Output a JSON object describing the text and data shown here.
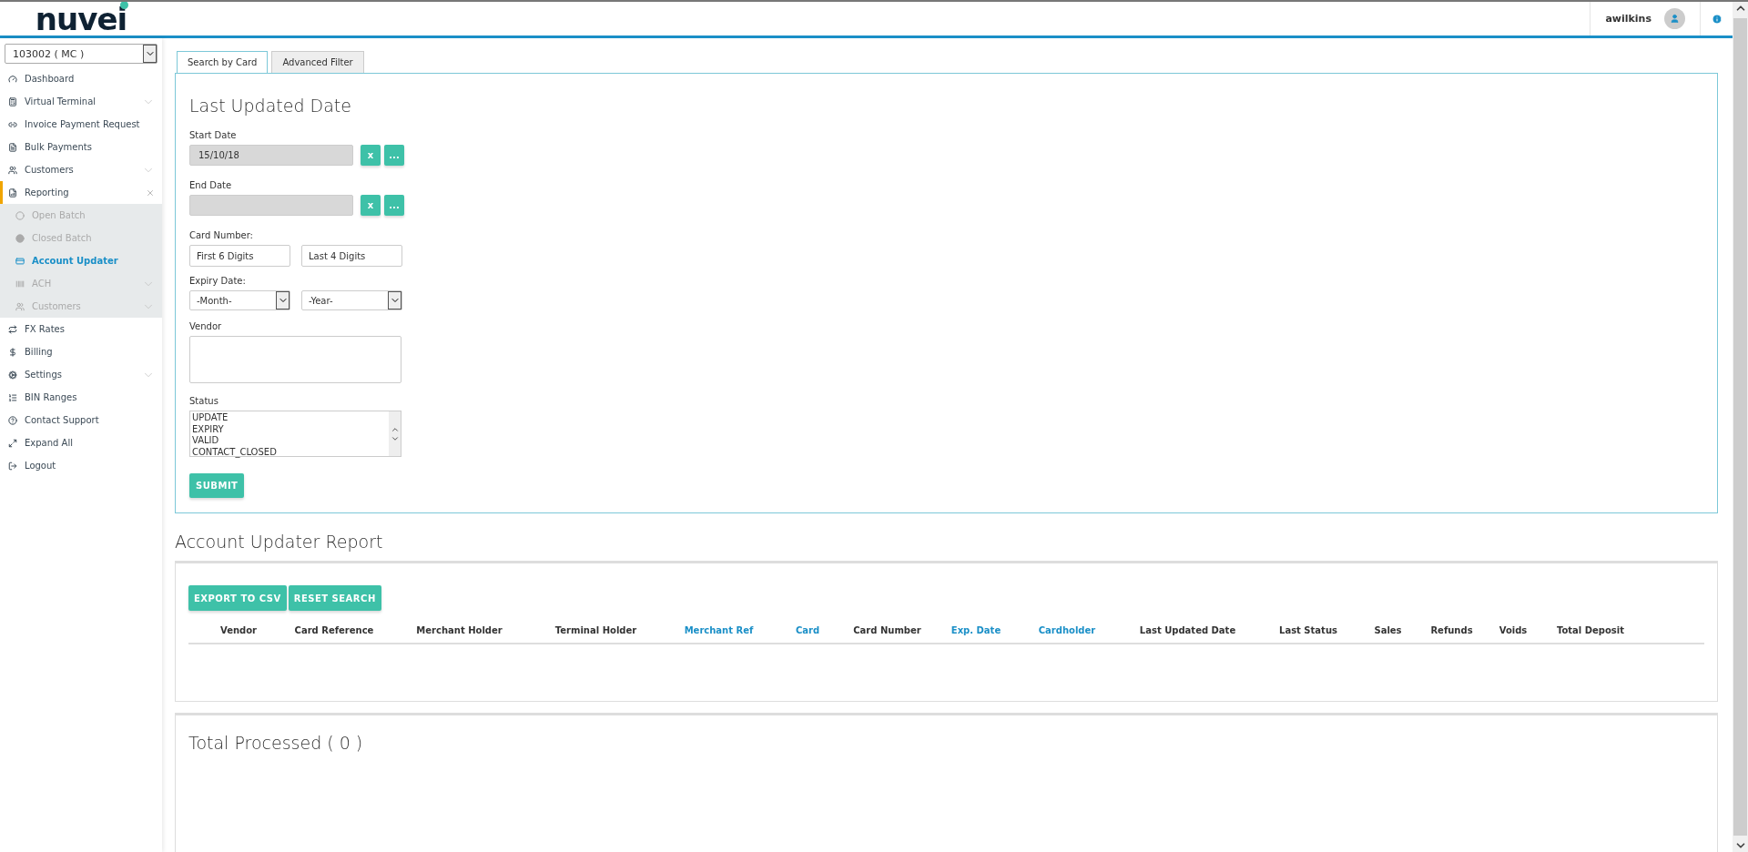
{
  "header": {
    "username": "awilkins"
  },
  "sidebar": {
    "merchant_select": "103002 ( MC )",
    "items": [
      {
        "kind": "dashboard",
        "label": "Dashboard"
      },
      {
        "kind": "calculator",
        "label": "Virtual Terminal",
        "expanded": false
      },
      {
        "kind": "link",
        "label": "Invoice Payment Request"
      },
      {
        "kind": "file",
        "label": "Bulk Payments"
      },
      {
        "kind": "users",
        "label": "Customers",
        "expanded": false
      },
      {
        "kind": "report",
        "label": "Reporting",
        "expanded": true,
        "children": [
          {
            "kind": "circle-outline",
            "label": "Open Batch",
            "selected": false
          },
          {
            "kind": "circle",
            "label": "Closed Batch",
            "selected": false
          },
          {
            "kind": "card",
            "label": "Account Updater",
            "selected": true
          },
          {
            "kind": "ach",
            "label": "ACH",
            "selected": false,
            "expanded": false
          },
          {
            "kind": "users",
            "label": "Customers",
            "selected": false,
            "expanded": false
          }
        ]
      },
      {
        "kind": "exchange",
        "label": "FX Rates"
      },
      {
        "kind": "dollar",
        "label": "Billing"
      },
      {
        "kind": "gears",
        "label": "Settings",
        "expanded": false
      },
      {
        "kind": "list",
        "label": "BIN Ranges"
      },
      {
        "kind": "help",
        "label": "Contact Support"
      },
      {
        "kind": "expand",
        "label": "Expand All"
      },
      {
        "kind": "logout",
        "label": "Logout"
      }
    ]
  },
  "tabs": [
    {
      "label": "Search by Card",
      "selected": true
    },
    {
      "label": "Advanced Filter",
      "selected": false
    }
  ],
  "filter": {
    "title": "Last Updated Date",
    "start_date": {
      "label": "Start Date",
      "value": "15/10/18",
      "clear": "x",
      "pick": "..."
    },
    "end_date": {
      "label": "End Date",
      "clear": "x",
      "pick": "..."
    },
    "card_number": {
      "label": "Card Number:",
      "first": "First 6 Digits",
      "last": "Last 4 Digits"
    },
    "expiry": {
      "label": "Expiry Date:",
      "month": "-Month-",
      "year": "-Year-"
    },
    "vendor": {
      "label": "Vendor"
    },
    "status": {
      "label": "Status",
      "options": [
        "UPDATE",
        "EXPIRY",
        "VALID",
        "CONTACT_CLOSED"
      ]
    },
    "submit": "SUBMIT"
  },
  "report": {
    "title": "Account Updater Report",
    "buttons": [
      "EXPORT TO CSV",
      "RESET SEARCH"
    ],
    "columns": [
      {
        "label": "Vendor",
        "sortable": false
      },
      {
        "label": "Card Reference",
        "sortable": false
      },
      {
        "label": "Merchant Holder",
        "sortable": false
      },
      {
        "label": "Terminal Holder",
        "sortable": false
      },
      {
        "label": "Merchant Ref",
        "sortable": true
      },
      {
        "label": "Card",
        "sortable": true
      },
      {
        "label": "Card Number",
        "sortable": false
      },
      {
        "label": "Exp. Date",
        "sortable": true
      },
      {
        "label": "Cardholder",
        "sortable": true
      },
      {
        "label": "Last Updated Date",
        "sortable": false
      },
      {
        "label": "Last Status",
        "sortable": false
      },
      {
        "label": "Sales",
        "sortable": false
      },
      {
        "label": "Refunds",
        "sortable": false
      },
      {
        "label": "Voids",
        "sortable": false
      },
      {
        "label": "Total Deposit",
        "sortable": false
      }
    ]
  },
  "total": {
    "title": "Total Processed ( 0 )"
  },
  "logo": {
    "text": "nuvei"
  }
}
